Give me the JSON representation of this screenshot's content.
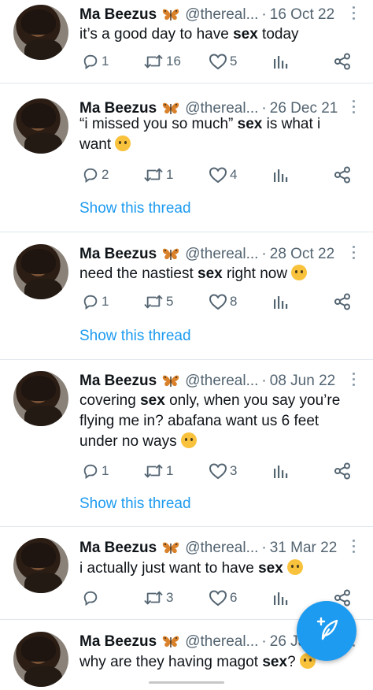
{
  "tweets": [
    {
      "name": "Ma Beezus",
      "handle": "@thereal...",
      "date": "16 Oct 22",
      "text_before": "it’s a good day to have ",
      "keyword": "sex",
      "text_after": " today",
      "reply_count": "1",
      "retweet_count": "16",
      "like_count": "5",
      "show_thread": ""
    },
    {
      "name": "Ma Beezus",
      "handle": "@thereal...",
      "date": "26 Dec 21",
      "text_before": "“i missed you so much” ",
      "keyword": "sex",
      "text_after": " is what i want",
      "emoji": "crying-face",
      "reply_count": "2",
      "retweet_count": "1",
      "like_count": "4",
      "show_thread": "Show this thread"
    },
    {
      "name": "Ma Beezus",
      "handle": "@thereal...",
      "date": "28 Oct 22",
      "text_before": "need the nastiest ",
      "keyword": "sex",
      "text_after": " right now",
      "emoji": "pleading-face",
      "reply_count": "1",
      "retweet_count": "5",
      "like_count": "8",
      "show_thread": "Show this thread"
    },
    {
      "name": "Ma Beezus",
      "handle": "@thereal...",
      "date": "08 Jun 22",
      "text_before": "covering ",
      "keyword": "sex",
      "text_after": " only, when you say you’re flying me in? abafana want us 6 feet under no ways",
      "emoji": "crying-face",
      "reply_count": "1",
      "retweet_count": "1",
      "like_count": "3",
      "show_thread": "Show this thread"
    },
    {
      "name": "Ma Beezus",
      "handle": "@thereal...",
      "date": "31 Mar 22",
      "text_before": "i actually just want to have ",
      "keyword": "sex",
      "text_after": "",
      "emoji": "disappointed-face",
      "reply_count": "",
      "retweet_count": "3",
      "like_count": "6",
      "show_thread": ""
    },
    {
      "name": "Ma Beezus",
      "handle": "@thereal...",
      "date": "26 Ja",
      "text_before": "why are they having magot ",
      "keyword": "sex",
      "text_after": "?",
      "emoji": "crying-face",
      "reply_count": "",
      "retweet_count": "",
      "like_count": "",
      "show_thread": ""
    }
  ],
  "colors": {
    "accent": "#1d9bf0",
    "muted": "#536471",
    "divider": "#e1e8ed"
  },
  "icons": {
    "reply": "reply-icon",
    "retweet": "retweet-icon",
    "like": "heart-icon",
    "analytics": "analytics-icon",
    "share": "share-icon",
    "compose": "compose-tweet-icon",
    "more": "more-icon"
  }
}
